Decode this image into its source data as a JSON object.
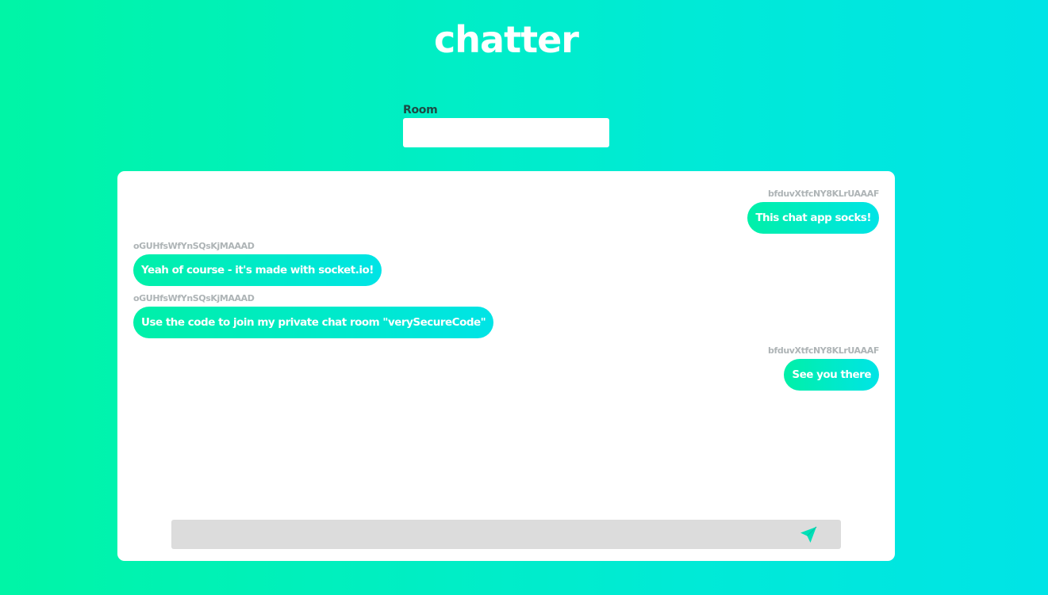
{
  "app": {
    "title": "chatter"
  },
  "room": {
    "label": "Room",
    "value": "",
    "placeholder": ""
  },
  "messages": [
    {
      "sender": "bfduvXtfcNY8KLrUAAAF",
      "text": "This chat app socks!",
      "mine": true
    },
    {
      "sender": "oGUHfsWfYnSQsKjMAAAD",
      "text": "Yeah of course - it's made with socket.io!",
      "mine": false
    },
    {
      "sender": "oGUHfsWfYnSQsKjMAAAD",
      "text": "Use the code to join my private chat room \"verySecureCode\"",
      "mine": false
    },
    {
      "sender": "bfduvXtfcNY8KLrUAAAF",
      "text": "See you there",
      "mine": true
    }
  ],
  "composer": {
    "value": "",
    "placeholder": "",
    "send_icon": "send-icon"
  },
  "colors": {
    "background_start": "#00f5a6",
    "background_end": "#00e4e6",
    "bubble_start": "#00f0a8",
    "bubble_end": "#00e4e6",
    "sender_text": "#aeb4b6",
    "label_text": "#1d4a45",
    "composer_bg": "#dcdcdc",
    "send_icon": "#00e0b8"
  }
}
